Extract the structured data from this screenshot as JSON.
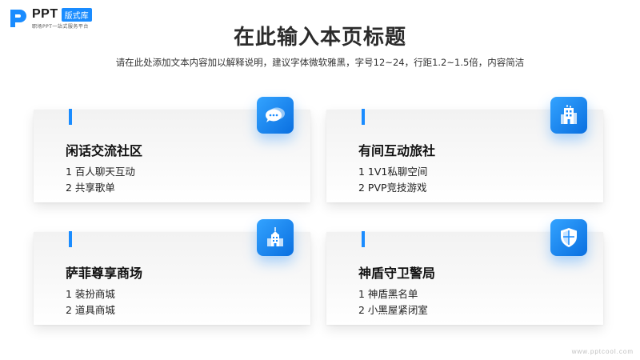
{
  "logo": {
    "brand": "PPT",
    "badge": "版式库",
    "tagline": "职场PPT一站式服务平台"
  },
  "slide": {
    "title": "在此输入本页标题",
    "subtitle": "请在此处添加文本内容加以解释说明，建议字体微软雅黑，字号12~24，行距1.2~1.5倍，内容简洁"
  },
  "accent_color": "#1a8cff",
  "cards": [
    {
      "title": "闲话交流社区",
      "line1": "1 百人聊天互动",
      "line2": "2 共享歌单",
      "icon": "chat-bubbles-icon"
    },
    {
      "title": "有间互动旅社",
      "line1": "1 1V1私聊空间",
      "line2": "2 PVP竞技游戏",
      "icon": "building-icon"
    },
    {
      "title": "萨菲尊享商场",
      "line1": "1 装扮商城",
      "line2": "2 道具商城",
      "icon": "mall-building-icon"
    },
    {
      "title": "神盾守卫警局",
      "line1": "1 神盾黑名单",
      "line2": "2 小黑屋紧闭室",
      "icon": "shield-icon"
    }
  ],
  "watermark": "www.pptcool.com"
}
